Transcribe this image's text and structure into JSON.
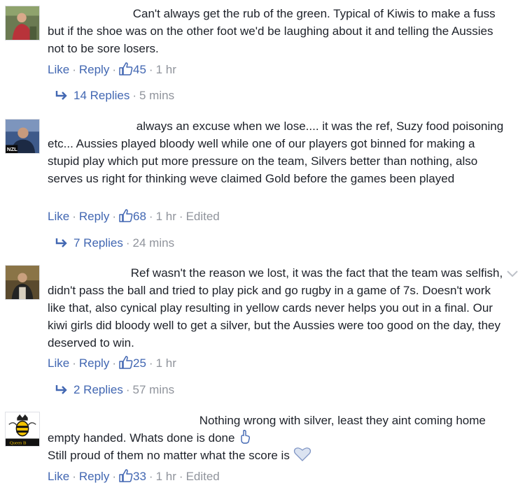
{
  "comments": [
    {
      "text": "Can't always get the rub of the green. Typical of Kiwis to make a fuss but if the shoe was on the other foot we'd be laughing about it and telling the Aussies not to be sore losers.",
      "actions": {
        "like": "Like",
        "reply": "Reply",
        "likes": "45",
        "time": "1 hr",
        "edited": ""
      },
      "replies": {
        "label": "14 Replies",
        "time": "5 mins"
      },
      "avatar": "avatar-man-red-shirt"
    },
    {
      "text": "always an excuse when we lose.... it was the ref, Suzy food poisoning etc... Aussies played bloody well while one of our players got binned for making a stupid play which put more pressure on the team, Silvers better than nothing, also serves us right for thinking weve claimed Gold before the games been played",
      "actions": {
        "like": "Like",
        "reply": "Reply",
        "likes": "68",
        "time": "1 hr",
        "edited": "Edited"
      },
      "replies": {
        "label": "7 Replies",
        "time": "24 mins"
      },
      "avatar": "avatar-nzl",
      "avatar_badge": "NZL"
    },
    {
      "text": "Ref wasn't the reason we lost, it was the fact that the team was selfish, didn't pass the ball and tried to play pick and go rugby in a game of 7s. Doesn't work like that, also cynical play resulting in yellow cards never helps you out in a final. Our kiwi girls did bloody well to get a silver, but the Aussies were too good on the day, they deserved to win.",
      "actions": {
        "like": "Like",
        "reply": "Reply",
        "likes": "25",
        "time": "1 hr",
        "edited": ""
      },
      "replies": {
        "label": "2 Replies",
        "time": "57 mins"
      },
      "avatar": "avatar-person-dark"
    },
    {
      "text_line1": "Nothing wrong with silver, least they aint coming home empty handed. Whats done is done",
      "text_line2": "Still proud of them no matter what the score is",
      "actions": {
        "like": "Like",
        "reply": "Reply",
        "likes": "33",
        "time": "1 hr",
        "edited": "Edited"
      },
      "avatar": "avatar-queen-b",
      "avatar_badge": "Queen B"
    }
  ],
  "colors": {
    "link": "#4267b2",
    "meta": "#90949c",
    "text": "#1d2129"
  },
  "icons": {
    "like": "thumbs-up-icon",
    "reply": "reply-arrow-icon",
    "menu": "chevron-down-icon",
    "emoji1": "pointing-finger-emoji",
    "emoji2": "heart-emoji"
  }
}
